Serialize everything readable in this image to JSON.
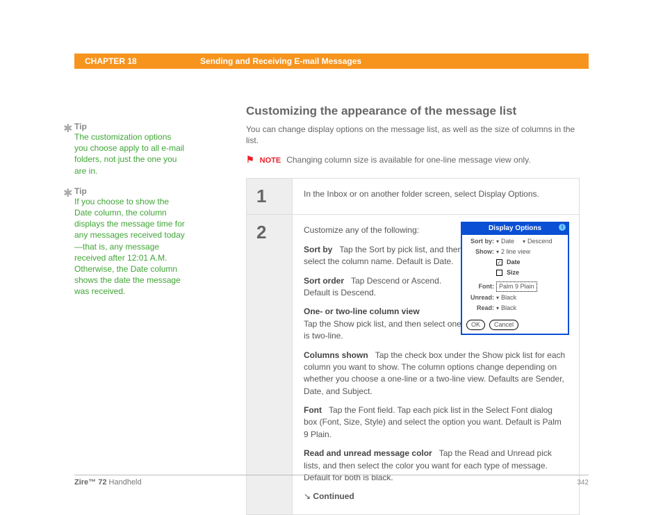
{
  "header": {
    "chapter": "CHAPTER 18",
    "title": "Sending and Receiving E-mail Messages"
  },
  "sidebar": {
    "tips": [
      {
        "label": "Tip",
        "body": "The customization options you choose apply to all e-mail folders, not just the one you are in."
      },
      {
        "label": "Tip",
        "body": "If you choose to show the Date column, the column displays the message time for any messages received today—that is, any message received after 12:01 A.M. Otherwise, the Date column shows the date the message was received."
      }
    ]
  },
  "main": {
    "section_title": "Customizing the appearance of the message list",
    "intro": "You can change display options on the message list, as well as the size of columns in the list.",
    "note": {
      "label": "NOTE",
      "text": "Changing column size is available for one-line message view only."
    },
    "steps": [
      {
        "num": "1",
        "body": "In the Inbox or on another folder screen, select Display Options."
      },
      {
        "num": "2",
        "lead": "Customize any of the following:",
        "items": [
          {
            "label": "Sort by",
            "text": "Tap the Sort by pick list, and then select the column name. Default is Date."
          },
          {
            "label": "Sort order",
            "text": "Tap Descend or Ascend. Default is Descend."
          },
          {
            "label": "One- or two-line column view",
            "text": "Tap the Show pick list, and then select one-line or two-line view. Default is two-line."
          },
          {
            "label": "Columns shown",
            "text": "Tap the check box under the Show pick list for each column you want to show. The column options change depending on whether you choose a one-line or a two-line view. Defaults are Sender, Date, and Subject."
          },
          {
            "label": "Font",
            "text": "Tap the Font field. Tap each pick list in the Select Font dialog box (Font, Size, Style) and select the option you want. Default is Palm 9 Plain."
          },
          {
            "label": "Read and unread message color",
            "text": "Tap the Read and Unread pick lists, and then select the color you want for each type of message. Default for both is black."
          }
        ],
        "continued": "Continued"
      }
    ]
  },
  "dialog": {
    "title": "Display Options",
    "sortby_label": "Sort by:",
    "sortby_value": "Date",
    "sortorder_value": "Descend",
    "show_label": "Show:",
    "show_value": "2 line view",
    "chk_date": "Date",
    "chk_size": "Size",
    "font_label": "Font:",
    "font_value": "Palm 9 Plain",
    "unread_label": "Unread:",
    "unread_value": "Black",
    "read_label": "Read:",
    "read_value": "Black",
    "ok": "OK",
    "cancel": "Cancel"
  },
  "footer": {
    "product_bold": "Zire™ 72",
    "product_rest": " Handheld",
    "page": "342"
  }
}
